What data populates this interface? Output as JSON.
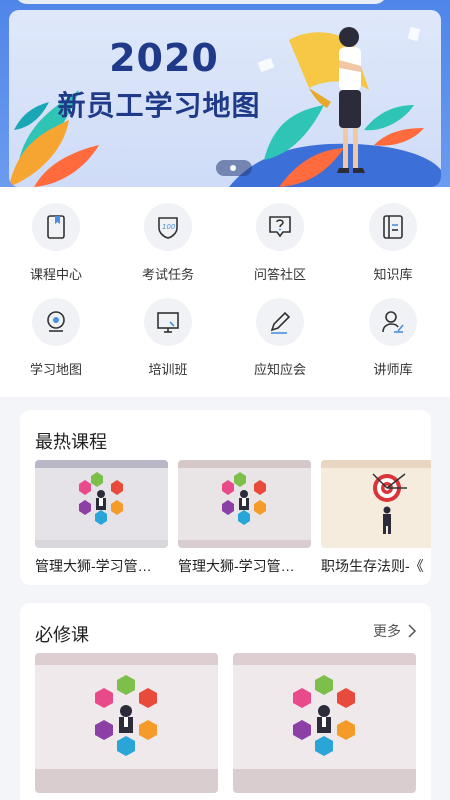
{
  "banner": {
    "year": "2020",
    "title": "新员工学习地图"
  },
  "menu": [
    {
      "label": "课程中心",
      "icon": "book-icon"
    },
    {
      "label": "考试任务",
      "icon": "exam-shield-icon"
    },
    {
      "label": "问答社区",
      "icon": "question-bubble-icon"
    },
    {
      "label": "知识库",
      "icon": "document-icon"
    },
    {
      "label": "学习地图",
      "icon": "location-pin-icon"
    },
    {
      "label": "培训班",
      "icon": "screen-board-icon"
    },
    {
      "label": "应知应会",
      "icon": "pencil-icon"
    },
    {
      "label": "讲师库",
      "icon": "teacher-icon"
    }
  ],
  "hot_courses": {
    "title": "最热课程",
    "items": [
      {
        "label": "管理大狮-学习管…"
      },
      {
        "label": "管理大狮-学习管…"
      },
      {
        "label": "职场生存法则-《"
      }
    ]
  },
  "required": {
    "title": "必修课",
    "more": "更多"
  },
  "colors": {
    "header_blue": "#4f86e8",
    "banner_text": "#1f3a88",
    "icon_accent": "#4a8fe0"
  }
}
